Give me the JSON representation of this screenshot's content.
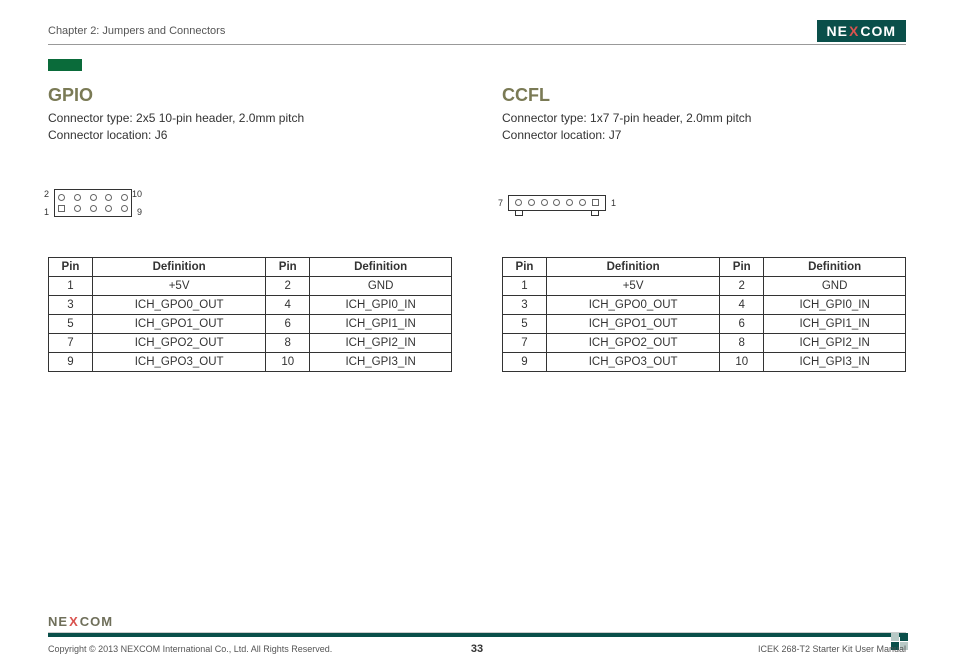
{
  "header": {
    "chapter": "Chapter 2: Jumpers and Connectors",
    "brand_pre": "NE",
    "brand_x": "X",
    "brand_post": "COM"
  },
  "left": {
    "title": "GPIO",
    "conn_type_line": "Connector type: 2x5 10-pin header, 2.0mm pitch",
    "conn_loc_line": "Connector location: J6",
    "diagram_labels": {
      "tl": "2",
      "tr": "10",
      "bl": "1",
      "br": "9"
    },
    "table": {
      "hdr_pin": "Pin",
      "hdr_def": "Definition",
      "rows": [
        {
          "p1": "1",
          "d1": "+5V",
          "p2": "2",
          "d2": "GND"
        },
        {
          "p1": "3",
          "d1": "ICH_GPO0_OUT",
          "p2": "4",
          "d2": "ICH_GPI0_IN"
        },
        {
          "p1": "5",
          "d1": "ICH_GPO1_OUT",
          "p2": "6",
          "d2": "ICH_GPI1_IN"
        },
        {
          "p1": "7",
          "d1": "ICH_GPO2_OUT",
          "p2": "8",
          "d2": "ICH_GPI2_IN"
        },
        {
          "p1": "9",
          "d1": "ICH_GPO3_OUT",
          "p2": "10",
          "d2": "ICH_GPI3_IN"
        }
      ]
    }
  },
  "right": {
    "title": "CCFL",
    "conn_type_line": "Connector type: 1x7 7-pin header, 2.0mm pitch",
    "conn_loc_line": "Connector location: J7",
    "diagram_labels": {
      "l": "7",
      "r": "1"
    },
    "table": {
      "hdr_pin": "Pin",
      "hdr_def": "Definition",
      "rows": [
        {
          "p1": "1",
          "d1": "+5V",
          "p2": "2",
          "d2": "GND"
        },
        {
          "p1": "3",
          "d1": "ICH_GPO0_OUT",
          "p2": "4",
          "d2": "ICH_GPI0_IN"
        },
        {
          "p1": "5",
          "d1": "ICH_GPO1_OUT",
          "p2": "6",
          "d2": "ICH_GPI1_IN"
        },
        {
          "p1": "7",
          "d1": "ICH_GPO2_OUT",
          "p2": "8",
          "d2": "ICH_GPI2_IN"
        },
        {
          "p1": "9",
          "d1": "ICH_GPO3_OUT",
          "p2": "10",
          "d2": "ICH_GPI3_IN"
        }
      ]
    }
  },
  "footer": {
    "copyright": "Copyright © 2013 NEXCOM International Co., Ltd. All Rights Reserved.",
    "page": "33",
    "manual": "ICEK 268-T2 Starter Kit User Manual"
  }
}
